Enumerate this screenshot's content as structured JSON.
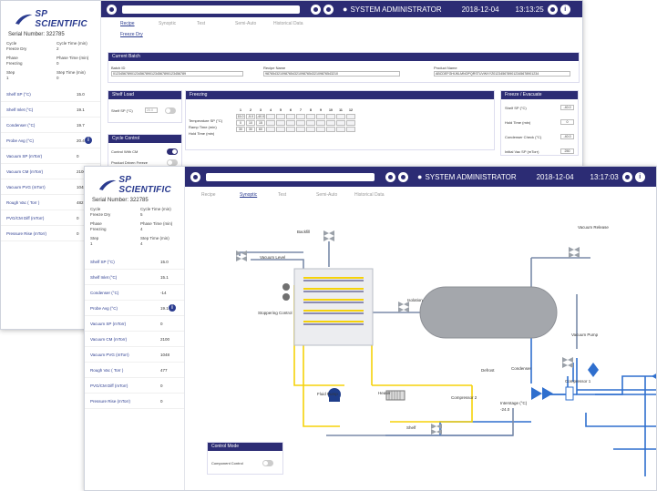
{
  "brand": {
    "name": "SP SCIENTIFIC"
  },
  "back": {
    "serial": "Serial Number: 322785",
    "status": [
      {
        "k": "Cycle",
        "v": "Freeze Dry",
        "k2": "Cycle Time (min)",
        "v2": "2"
      },
      {
        "k": "Phase",
        "v": "Freezing",
        "k2": "Phase Time (min)",
        "v2": "0"
      },
      {
        "k": "Step",
        "v": "1",
        "k2": "Step Time (min)",
        "v2": "0"
      }
    ],
    "readings": [
      {
        "label": "Shelf SP (°C)",
        "value": "15.0"
      },
      {
        "label": "Shelf Inlet (°C)",
        "value": "19.1"
      },
      {
        "label": "Condenser (°C)",
        "value": "19.7"
      },
      {
        "label": "Probe Avg (°C)",
        "value": "20.4"
      },
      {
        "label": "Vacuum SP (mTorr)",
        "value": "0"
      },
      {
        "label": "Vacuum CM (mTorr)",
        "value": "2100"
      },
      {
        "label": "Vacuum PVG (mTorr)",
        "value": "1048"
      },
      {
        "label": "Rough Vac (  Torr )",
        "value": "482"
      },
      {
        "label": "PVG/CM Diff (mTorr)",
        "value": "0"
      },
      {
        "label": "Pressure Rise (mTorr)",
        "value": "0"
      }
    ],
    "topbar": {
      "user": "SYSTEM ADMINISTRATOR",
      "date": "2018-12-04",
      "time": "13:13:25"
    },
    "tabs": [
      "Recipe",
      "Synoptic",
      "Test",
      "Semi-Auto",
      "Historical Data"
    ],
    "subtab": "Freeze Dry",
    "batch": {
      "title": "Current Batch",
      "batch_id_label": "Batch ID",
      "batch_id": "0123456789012345678901234567890123456789",
      "recipe_label": "Recipe Name",
      "recipe": "9876543210987654321098765432109876543210",
      "product_label": "Product Name",
      "product": "ABCDEFGHIJKLMNOPQRSTUVWXYZ0123456789012345678901234"
    },
    "shelf_load": {
      "title": "Shelf Load",
      "label": "Shelf SP (°C)",
      "value": "20.0"
    },
    "cycle_control": {
      "title": "Cycle Control",
      "items": [
        {
          "label": "Control With CM",
          "on": true
        },
        {
          "label": "Product Driven Freeze",
          "on": false
        }
      ]
    },
    "freezing": {
      "title": "Freezing",
      "cols": [
        "1",
        "2",
        "3",
        "4",
        "5",
        "6",
        "7",
        "8",
        "9",
        "10",
        "11",
        "12"
      ],
      "rows": [
        {
          "label": "Temperature SP (°C)",
          "vals": [
            "15.0",
            "-5.0",
            "-40.0"
          ]
        },
        {
          "label": "Ramp Time (min)",
          "vals": [
            "0",
            "10",
            "15"
          ]
        },
        {
          "label": "Hold Time (min)",
          "vals": [
            "30",
            "30",
            "60"
          ]
        }
      ]
    },
    "freeze_evac": {
      "title": "Freeze / Evacuate",
      "items": [
        {
          "label": "Shelf SP (°C)",
          "value": "-40.0"
        },
        {
          "label": "Hold Time (min)",
          "value": "0"
        },
        {
          "label": "Condenser Check (°C)",
          "value": "-40.0"
        },
        {
          "label": "Initial Vac SP (mTorr)",
          "value": "250"
        }
      ]
    }
  },
  "front": {
    "serial": "Serial Number: 322785",
    "status": [
      {
        "k": "Cycle",
        "v": "Freeze Dry",
        "k2": "Cycle Time (min)",
        "v2": "5"
      },
      {
        "k": "Phase",
        "v": "Freezing",
        "k2": "Phase Time (min)",
        "v2": "4"
      },
      {
        "k": "Step",
        "v": "1",
        "k2": "Step Time (min)",
        "v2": "4"
      }
    ],
    "readings": [
      {
        "label": "Shelf SP (°C)",
        "value": "15.0"
      },
      {
        "label": "Shelf Inlet (°C)",
        "value": "15.1"
      },
      {
        "label": "Condenser (°C)",
        "value": "-14"
      },
      {
        "label": "Probe Avg (°C)",
        "value": "19.1"
      },
      {
        "label": "Vacuum SP (mTorr)",
        "value": "0"
      },
      {
        "label": "Vacuum CM (mTorr)",
        "value": "2100"
      },
      {
        "label": "Vacuum PVG (mTorr)",
        "value": "1048"
      },
      {
        "label": "Rough Vac (  Torr )",
        "value": "477"
      },
      {
        "label": "PVG/CM Diff (mTorr)",
        "value": "0"
      },
      {
        "label": "Pressure Rise (mTorr)",
        "value": "0"
      }
    ],
    "topbar": {
      "user": "SYSTEM ADMINISTRATOR",
      "date": "2018-12-04",
      "time": "13:17:03"
    },
    "tabs": [
      "Recipe",
      "Synoptic",
      "Test",
      "Semi-Auto",
      "Historical Data"
    ],
    "diagram": {
      "vacuum_release": "Vacuum Release",
      "backfill": "Backfill",
      "vacuum_level": "Vacuum Level",
      "isolation": "Isolation",
      "stoppering": "Stoppering Control",
      "vacuum_pump": "Vacuum Pump",
      "defrost": "Defrost",
      "condenser": "Condenser",
      "fluid_pump": "Fluid Pump",
      "heater": "Heater",
      "compressor2": "Compressor 2",
      "compressor1": "Compressor 1",
      "interstage": "Interstage (°C)",
      "interstage_value": "-24.0",
      "shelf": "Shelf"
    },
    "control_mode": {
      "title": "Control Mode",
      "label": "Component Control",
      "on": false
    }
  },
  "colors": {
    "navy": "#2c2c74",
    "yellow": "#f5d20a",
    "blue": "#2f6fce",
    "valve": "#9aa0a8"
  }
}
